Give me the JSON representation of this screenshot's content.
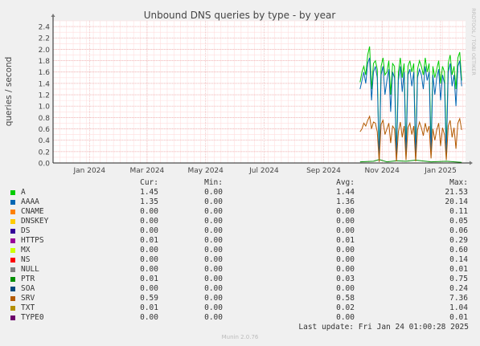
{
  "chart_data": {
    "type": "line",
    "title": "Unbound DNS queries by type - by year",
    "ylabel": "queries / second",
    "side_label": "RRDTOOL / TOBI OETIKER",
    "ylim": [
      0,
      2.5
    ],
    "yticks": [
      "0.0",
      "0.2",
      "0.4",
      "0.6",
      "0.8",
      "1.0",
      "1.2",
      "1.4",
      "1.6",
      "1.8",
      "2.0",
      "2.2",
      "2.4"
    ],
    "x_domain": [
      "2023-11-24",
      "2025-01-27"
    ],
    "xticks": [
      {
        "date": "2024-01-01",
        "label": "Jan 2024"
      },
      {
        "date": "2024-03-01",
        "label": "Mar 2024"
      },
      {
        "date": "2024-05-01",
        "label": "May 2024"
      },
      {
        "date": "2024-07-01",
        "label": "Jul 2024"
      },
      {
        "date": "2024-09-01",
        "label": "Sep 2024"
      },
      {
        "date": "2024-11-01",
        "label": "Nov 2024"
      },
      {
        "date": "2025-01-01",
        "label": "Jan 2025"
      }
    ],
    "grid": true,
    "series": [
      {
        "name": "A",
        "color": "#00cc00",
        "x": [
          "2024-10-09",
          "2024-10-11",
          "2024-10-13",
          "2024-10-15",
          "2024-10-17",
          "2024-10-19",
          "2024-10-21",
          "2024-10-23",
          "2024-10-25",
          "2024-10-27",
          "2024-10-29",
          "2024-10-31",
          "2024-11-02",
          "2024-11-04",
          "2024-11-06",
          "2024-11-08",
          "2024-11-10",
          "2024-11-12",
          "2024-11-14",
          "2024-11-16",
          "2024-11-18",
          "2024-11-20",
          "2024-11-22",
          "2024-11-24",
          "2024-11-26",
          "2024-11-28",
          "2024-11-30",
          "2024-12-02",
          "2024-12-04",
          "2024-12-06",
          "2024-12-08",
          "2024-12-10",
          "2024-12-12",
          "2024-12-14",
          "2024-12-16",
          "2024-12-18",
          "2024-12-20",
          "2024-12-22",
          "2024-12-24",
          "2024-12-26",
          "2024-12-28",
          "2024-12-30",
          "2025-01-01",
          "2025-01-03",
          "2025-01-05",
          "2025-01-07",
          "2025-01-09",
          "2025-01-11",
          "2025-01-13",
          "2025-01-15",
          "2025-01-17",
          "2025-01-19",
          "2025-01-21",
          "2025-01-23"
        ],
        "y": [
          1.42,
          1.6,
          1.7,
          1.55,
          1.9,
          2.05,
          1.3,
          1.75,
          1.8,
          1.65,
          0.05,
          1.7,
          1.85,
          1.55,
          1.6,
          1.8,
          1.2,
          1.75,
          1.7,
          0.1,
          1.6,
          1.85,
          1.5,
          1.75,
          0.2,
          1.7,
          1.8,
          1.6,
          1.75,
          0.1,
          1.65,
          1.8,
          1.7,
          1.55,
          1.85,
          1.6,
          1.75,
          0.3,
          1.7,
          1.5,
          1.65,
          1.8,
          1.4,
          1.7,
          1.6,
          0.25,
          1.75,
          1.9,
          1.55,
          1.7,
          1.3,
          1.85,
          1.95,
          1.45
        ]
      },
      {
        "name": "AAAA",
        "color": "#0066b3",
        "x": [
          "2024-10-09",
          "2024-10-11",
          "2024-10-13",
          "2024-10-15",
          "2024-10-17",
          "2024-10-19",
          "2024-10-21",
          "2024-10-23",
          "2024-10-25",
          "2024-10-27",
          "2024-10-29",
          "2024-10-31",
          "2024-11-02",
          "2024-11-04",
          "2024-11-06",
          "2024-11-08",
          "2024-11-10",
          "2024-11-12",
          "2024-11-14",
          "2024-11-16",
          "2024-11-18",
          "2024-11-20",
          "2024-11-22",
          "2024-11-24",
          "2024-11-26",
          "2024-11-28",
          "2024-11-30",
          "2024-12-02",
          "2024-12-04",
          "2024-12-06",
          "2024-12-08",
          "2024-12-10",
          "2024-12-12",
          "2024-12-14",
          "2024-12-16",
          "2024-12-18",
          "2024-12-20",
          "2024-12-22",
          "2024-12-24",
          "2024-12-26",
          "2024-12-28",
          "2024-12-30",
          "2025-01-01",
          "2025-01-03",
          "2025-01-05",
          "2025-01-07",
          "2025-01-09",
          "2025-01-11",
          "2025-01-13",
          "2025-01-15",
          "2025-01-17",
          "2025-01-19",
          "2025-01-21",
          "2025-01-23"
        ],
        "y": [
          1.3,
          1.45,
          1.6,
          1.4,
          1.75,
          1.85,
          1.1,
          1.6,
          1.7,
          1.5,
          0.02,
          1.55,
          1.7,
          1.2,
          1.45,
          1.65,
          0.9,
          1.6,
          1.5,
          0.05,
          1.45,
          1.7,
          1.25,
          1.6,
          0.1,
          1.55,
          1.65,
          1.35,
          1.6,
          0.05,
          1.5,
          1.65,
          1.55,
          1.3,
          1.7,
          1.45,
          1.6,
          0.15,
          1.55,
          1.2,
          1.5,
          1.65,
          1.1,
          1.55,
          1.4,
          0.1,
          1.6,
          1.75,
          1.35,
          1.55,
          1.0,
          1.7,
          1.8,
          1.35
        ]
      },
      {
        "name": "CNAME",
        "color": "#ff8000",
        "x": [],
        "y": []
      },
      {
        "name": "DNSKEY",
        "color": "#ffcc00",
        "x": [],
        "y": []
      },
      {
        "name": "DS",
        "color": "#330099",
        "x": [],
        "y": []
      },
      {
        "name": "HTTPS",
        "color": "#990099",
        "x": [],
        "y": []
      },
      {
        "name": "MX",
        "color": "#ccff00",
        "x": [],
        "y": []
      },
      {
        "name": "NS",
        "color": "#ff0000",
        "x": [],
        "y": []
      },
      {
        "name": "NULL",
        "color": "#808080",
        "x": [],
        "y": []
      },
      {
        "name": "PTR",
        "color": "#008f00",
        "x": [
          "2024-10-09",
          "2024-10-23",
          "2024-10-29",
          "2024-11-06",
          "2024-11-16",
          "2024-11-26",
          "2024-12-06",
          "2024-12-22",
          "2025-01-07",
          "2025-01-23"
        ],
        "y": [
          0.02,
          0.03,
          0.06,
          0.02,
          0.04,
          0.03,
          0.05,
          0.02,
          0.03,
          0.01
        ]
      },
      {
        "name": "SOA",
        "color": "#00487d",
        "x": [],
        "y": []
      },
      {
        "name": "SRV",
        "color": "#b35a00",
        "x": [
          "2024-10-09",
          "2024-10-11",
          "2024-10-13",
          "2024-10-15",
          "2024-10-17",
          "2024-10-19",
          "2024-10-21",
          "2024-10-23",
          "2024-10-25",
          "2024-10-27",
          "2024-10-29",
          "2024-10-31",
          "2024-11-02",
          "2024-11-04",
          "2024-11-06",
          "2024-11-08",
          "2024-11-10",
          "2024-11-12",
          "2024-11-14",
          "2024-11-16",
          "2024-11-18",
          "2024-11-20",
          "2024-11-22",
          "2024-11-24",
          "2024-11-26",
          "2024-11-28",
          "2024-11-30",
          "2024-12-02",
          "2024-12-04",
          "2024-12-06",
          "2024-12-08",
          "2024-12-10",
          "2024-12-12",
          "2024-12-14",
          "2024-12-16",
          "2024-12-18",
          "2024-12-20",
          "2024-12-22",
          "2024-12-24",
          "2024-12-26",
          "2024-12-28",
          "2024-12-30",
          "2025-01-01",
          "2025-01-03",
          "2025-01-05",
          "2025-01-07",
          "2025-01-09",
          "2025-01-11",
          "2025-01-13",
          "2025-01-15",
          "2025-01-17",
          "2025-01-19",
          "2025-01-21",
          "2025-01-23"
        ],
        "y": [
          0.55,
          0.6,
          0.7,
          0.65,
          0.75,
          0.82,
          0.6,
          0.72,
          0.7,
          0.55,
          0.02,
          0.68,
          0.75,
          0.5,
          0.6,
          0.7,
          0.35,
          0.65,
          0.6,
          0.03,
          0.55,
          0.72,
          0.45,
          0.65,
          0.05,
          0.62,
          0.7,
          0.5,
          0.65,
          0.03,
          0.58,
          0.72,
          0.62,
          0.48,
          0.7,
          0.55,
          0.65,
          0.08,
          0.6,
          0.4,
          0.58,
          0.7,
          0.3,
          0.62,
          0.5,
          0.05,
          0.65,
          0.75,
          0.45,
          0.62,
          0.25,
          0.7,
          0.78,
          0.58
        ]
      },
      {
        "name": "TXT",
        "color": "#b38f00",
        "x": [],
        "y": []
      },
      {
        "name": "TYPE0",
        "color": "#6b006b",
        "x": [],
        "y": []
      }
    ]
  },
  "legend": {
    "header": {
      "cur": "Cur:",
      "min": "Min:",
      "avg": "Avg:",
      "max": "Max:"
    },
    "rows": [
      {
        "name": "A",
        "color": "#00cc00",
        "cur": "1.45",
        "min": "0.00",
        "avg": "1.44",
        "max": "21.53"
      },
      {
        "name": "AAAA",
        "color": "#0066b3",
        "cur": "1.35",
        "min": "0.00",
        "avg": "1.36",
        "max": "20.14"
      },
      {
        "name": "CNAME",
        "color": "#ff8000",
        "cur": "0.00",
        "min": "0.00",
        "avg": "0.00",
        "max": "0.11"
      },
      {
        "name": "DNSKEY",
        "color": "#ffcc00",
        "cur": "0.00",
        "min": "0.00",
        "avg": "0.00",
        "max": "0.05"
      },
      {
        "name": "DS",
        "color": "#330099",
        "cur": "0.00",
        "min": "0.00",
        "avg": "0.00",
        "max": "0.06"
      },
      {
        "name": "HTTPS",
        "color": "#990099",
        "cur": "0.01",
        "min": "0.00",
        "avg": "0.01",
        "max": "0.29"
      },
      {
        "name": "MX",
        "color": "#ccff00",
        "cur": "0.00",
        "min": "0.00",
        "avg": "0.00",
        "max": "0.60"
      },
      {
        "name": "NS",
        "color": "#ff0000",
        "cur": "0.00",
        "min": "0.00",
        "avg": "0.00",
        "max": "0.14"
      },
      {
        "name": "NULL",
        "color": "#808080",
        "cur": "0.00",
        "min": "0.00",
        "avg": "0.00",
        "max": "0.01"
      },
      {
        "name": "PTR",
        "color": "#008f00",
        "cur": "0.01",
        "min": "0.00",
        "avg": "0.03",
        "max": "0.75"
      },
      {
        "name": "SOA",
        "color": "#00487d",
        "cur": "0.00",
        "min": "0.00",
        "avg": "0.00",
        "max": "0.24"
      },
      {
        "name": "SRV",
        "color": "#b35a00",
        "cur": "0.59",
        "min": "0.00",
        "avg": "0.58",
        "max": "7.36"
      },
      {
        "name": "TXT",
        "color": "#b38f00",
        "cur": "0.01",
        "min": "0.00",
        "avg": "0.02",
        "max": "1.04"
      },
      {
        "name": "TYPE0",
        "color": "#6b006b",
        "cur": "0.00",
        "min": "0.00",
        "avg": "0.00",
        "max": "0.01"
      }
    ]
  },
  "last_update": "Last update: Fri Jan 24 01:00:28 2025",
  "footer": "Munin 2.0.76"
}
